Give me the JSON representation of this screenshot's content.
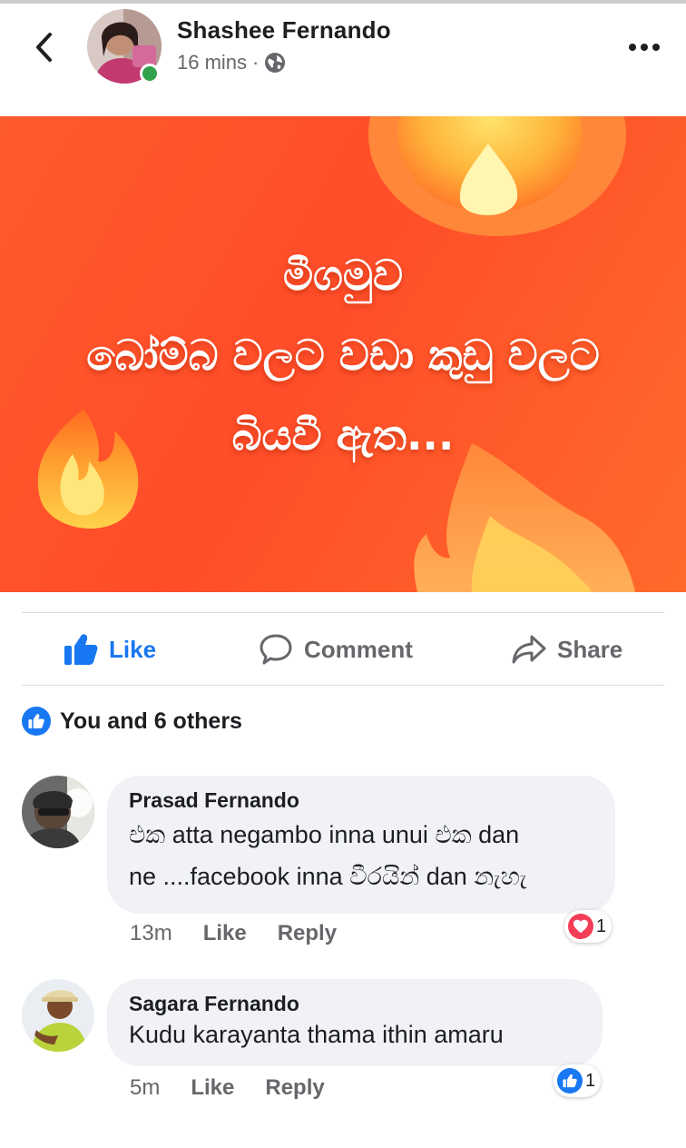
{
  "post": {
    "author": "Shashee Fernando",
    "time": "16 mins",
    "separator": "·",
    "privacy_icon": "globe-icon",
    "image_text": {
      "line1": "මීගමුව",
      "line2": "බෝම්බ වලට වඩා කුඩු වලට",
      "line3": "බියවී ඇත..."
    }
  },
  "actions": {
    "like": "Like",
    "comment": "Comment",
    "share": "Share"
  },
  "reactions": {
    "summary": "You and 6 others"
  },
  "comments": [
    {
      "author": "Prasad Fernando",
      "line1": "එක atta negambo inna unui එක dan",
      "line2": "ne ....facebook inna වීරයින් dan නැහැ",
      "time": "13m",
      "like": "Like",
      "reply": "Reply",
      "reaction_icon": "love-icon",
      "reaction_count": "1"
    },
    {
      "author": "Sagara Fernando",
      "line1": "Kudu karayanta thama ithin amaru",
      "time": "5m",
      "like": "Like",
      "reply": "Reply",
      "reaction_icon": "like-icon",
      "reaction_count": "1"
    }
  ],
  "colors": {
    "facebook_blue": "#1877f2",
    "online_green": "#31a24c",
    "love_red": "#f33e58",
    "post_orange": "#ff5a2c"
  }
}
